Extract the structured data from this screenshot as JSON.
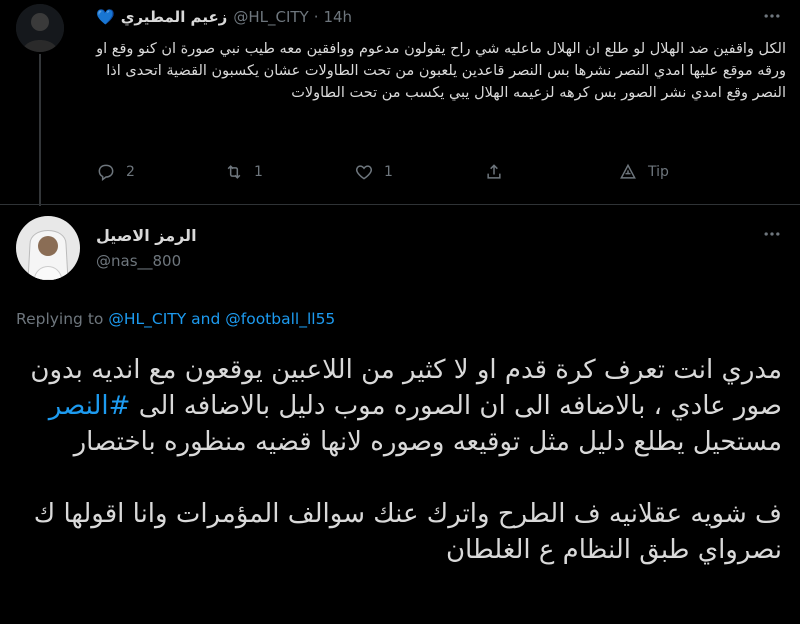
{
  "parent_tweet": {
    "display_name": "زعيم المطيري",
    "heart_emoji": "💙",
    "handle": "@HL_CITY",
    "dot": "·",
    "time": "14h",
    "text": "الكل واقفين ضد الهلال لو طلع ان الهلال ماعليه شي راح يقولون مدعوم ووافقين معه طيب نبي صورة ان كنو وقع او ورقه موقع عليها امدي النصر نشرها بس النصر قاعدين يلعبون من تحت الطاولات عشان يكسبون القضية اتحدى اذا النصر وقع امدي نشر الصور بس كرهه لزعيمه الهلال يبي يكسب من تحت الطاولات",
    "actions": {
      "reply_count": "2",
      "retweet_count": "1",
      "like_count": "1",
      "tip_label": "Tip"
    }
  },
  "reply_tweet": {
    "display_name": "الرمز الاصيل",
    "handle": "@nas__800",
    "replying_to_prefix": "Replying to",
    "replying_to_user1": "@HL_CITY",
    "replying_to_and": "and",
    "replying_to_user2": "@football_ll55",
    "text_part1": "مدري انت تعرف كرة قدم او لا كثير من اللاعبين يوقعون مع انديه بدون صور عادي ، بالاضافه الى ان الصوره موب دليل بالاضافه الى ",
    "hashtag": "#النصر",
    "text_part2": " مستحيل يطلع دليل مثل توقيعه وصوره لانها قضيه منظوره باختصار\n\nف شويه عقلانيه ف الطرح واترك عنك سوالف المؤمرات وانا اقولها ك نصرواي طبق النظام ع الغلطان"
  },
  "colors": {
    "background": "#000000",
    "text": "#d9d9d9",
    "muted": "#6e767d",
    "accent": "#1d9bf0",
    "divider": "#2f3336"
  }
}
